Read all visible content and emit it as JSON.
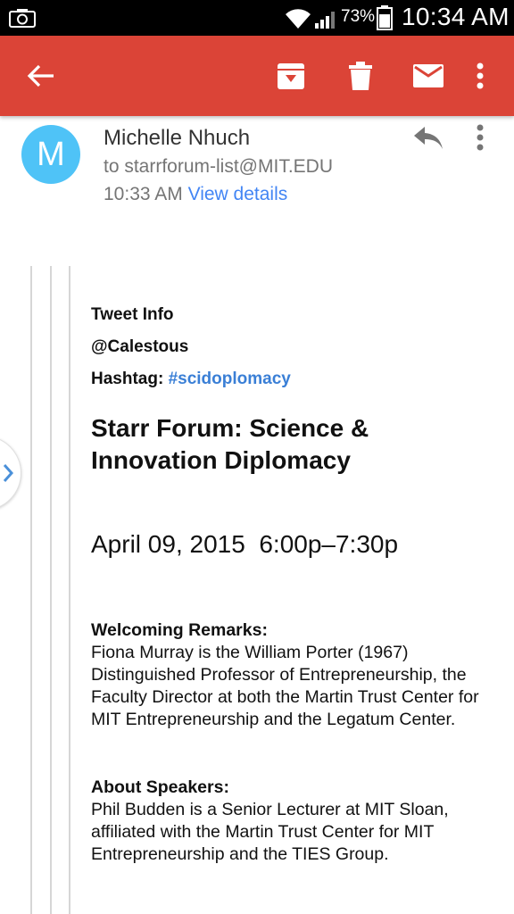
{
  "status_bar": {
    "battery_percent": "73%",
    "time": "10:34 AM",
    "icons": [
      "camera-icon",
      "wifi-icon",
      "signal-icon",
      "battery-icon"
    ]
  },
  "app_bar": {
    "color": "#db4437",
    "icons": [
      "back-arrow-icon",
      "archive-icon",
      "delete-icon",
      "mark-unread-icon",
      "more-vert-icon"
    ]
  },
  "message": {
    "avatar_letter": "M",
    "avatar_color": "#4fc3f7",
    "sender": "Michelle Nhuch",
    "to": "to starrforum-list@MIT.EDU",
    "time": "10:33 AM",
    "view_details": "View details"
  },
  "body": {
    "tweet_info": "Tweet Info",
    "handle": "@Calestous",
    "hashtag_label": "Hashtag:",
    "hashtag": "#scidoplomacy",
    "title": "Starr Forum: Science & Innovation Diplomacy",
    "date": "April 09, 2015  6:00p–7:30p",
    "welcoming_heading": "Welcoming Remarks:",
    "welcoming_text": "Fiona Murray is the William Porter (1967) Distinguished Professor of Entrepreneurship, the Faculty Director at both the Martin Trust Center for MIT Entrepreneurship and the Legatum Center.",
    "speakers_heading": "About Speakers:",
    "speakers_text": "Phil Budden is a Senior Lecturer at MIT Sloan, affiliated with the Martin Trust Center for MIT Entrepreneurship and the TIES Group."
  }
}
